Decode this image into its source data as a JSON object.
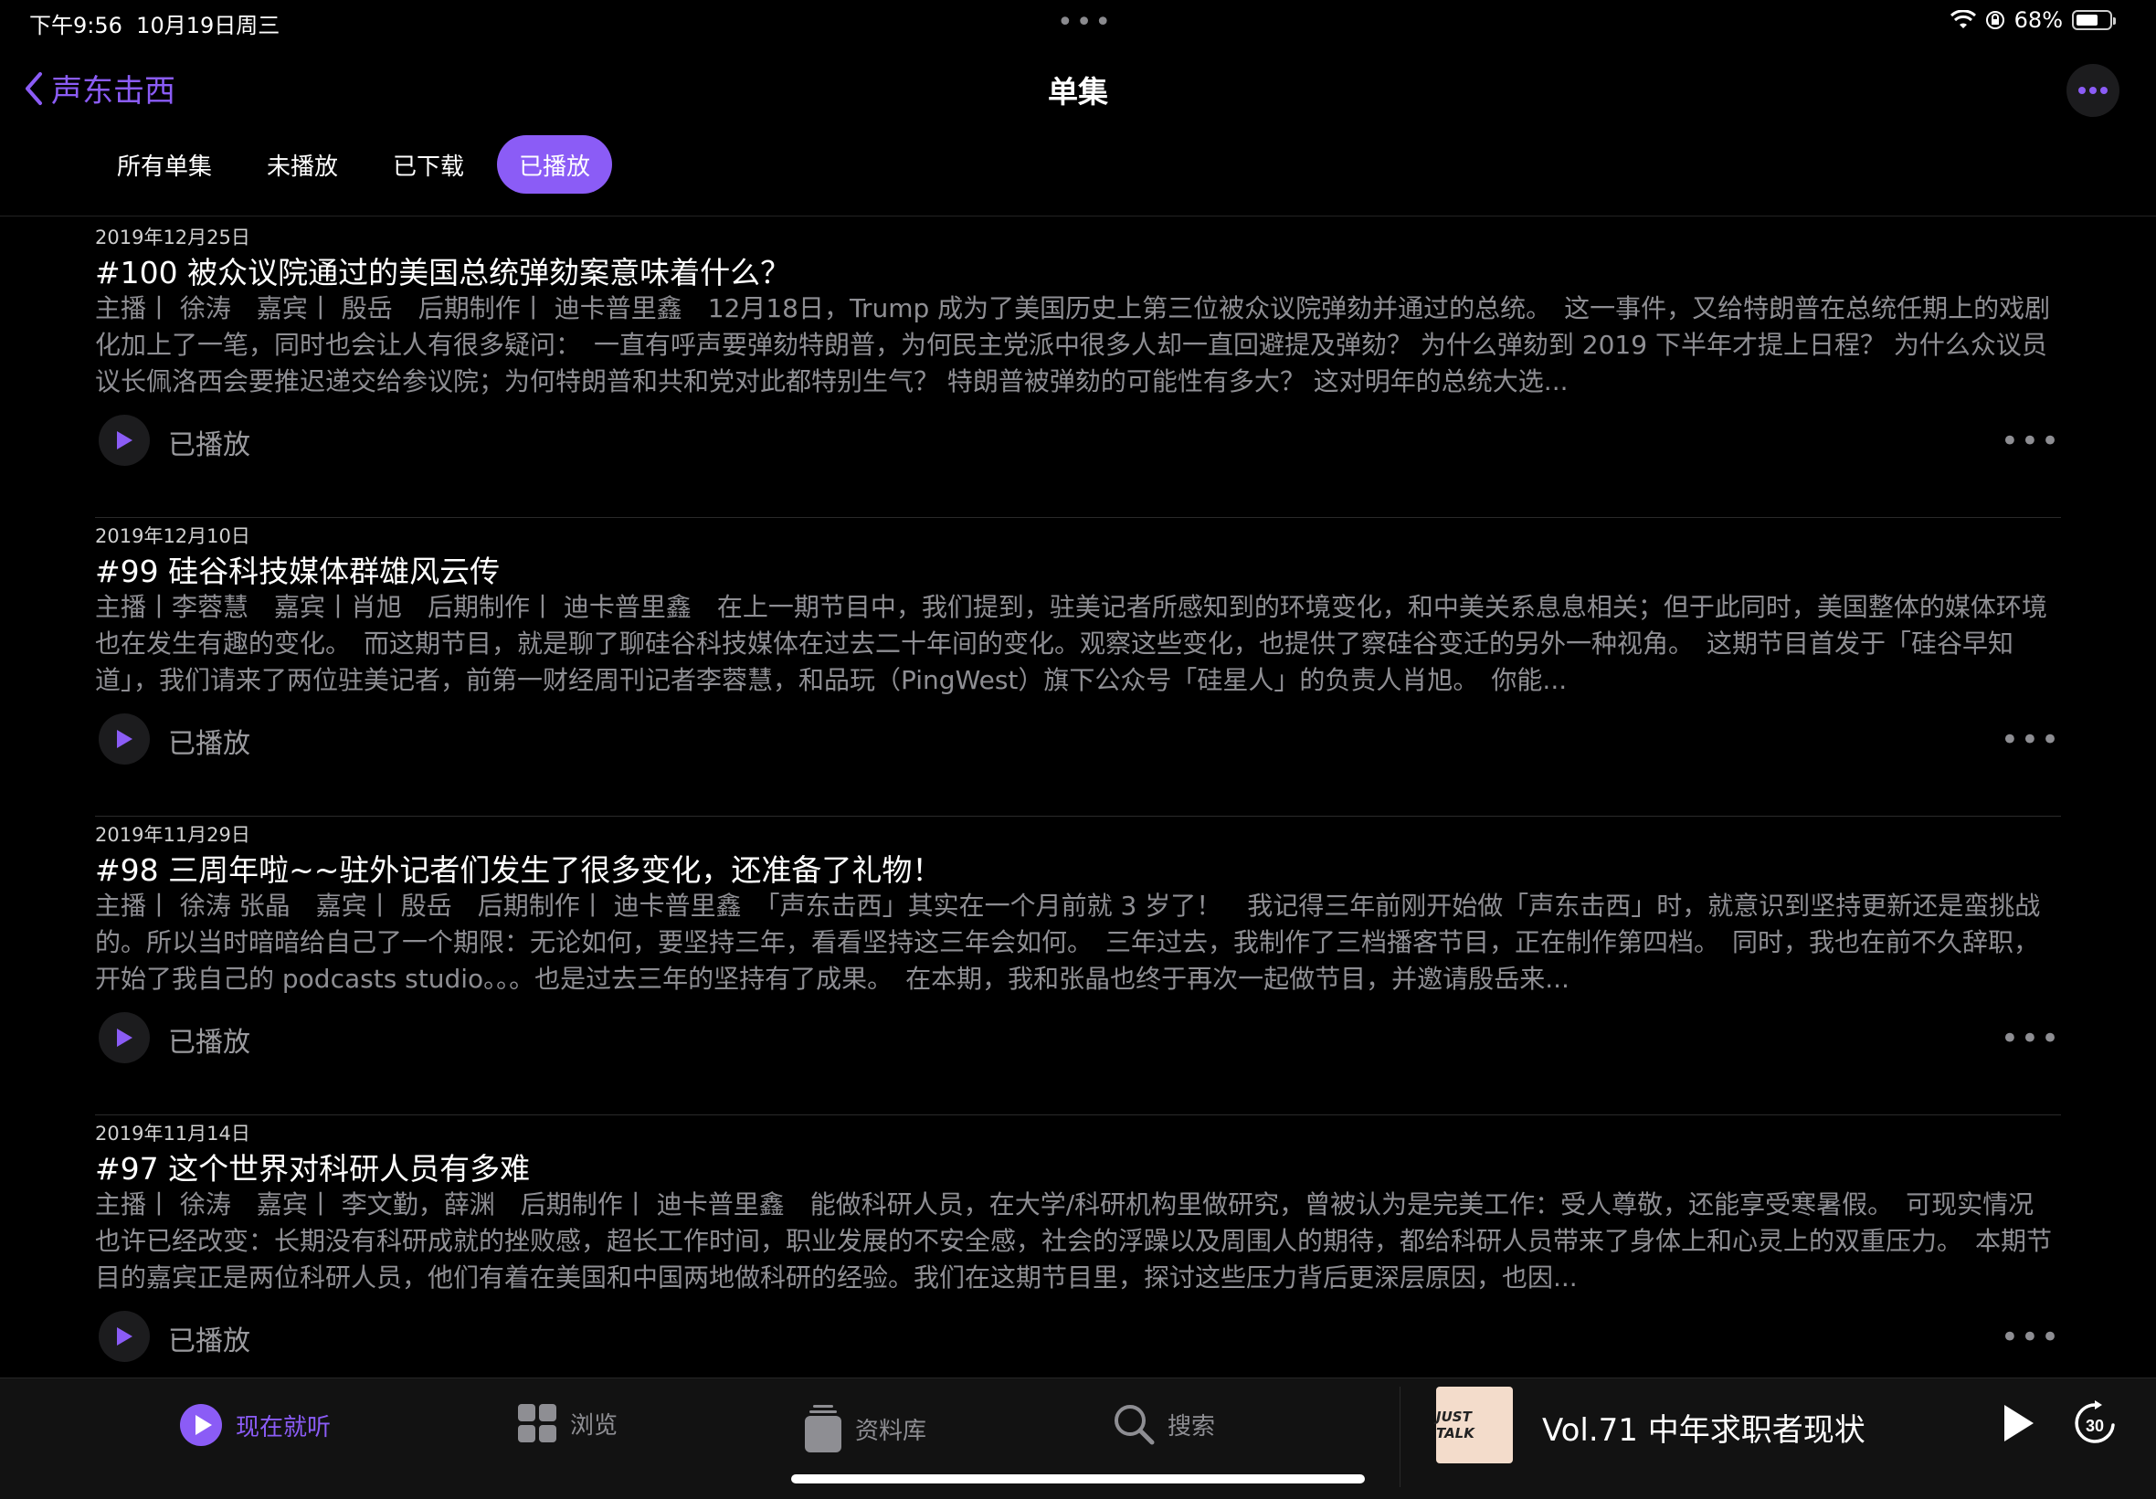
{
  "status_bar": {
    "time": "下午9:56",
    "date": "10月19日周三",
    "battery": "68%",
    "battery_level": 0.68
  },
  "nav": {
    "back_label": "声东击西",
    "title": "单集"
  },
  "tabs": [
    {
      "label": "所有单集",
      "active": false
    },
    {
      "label": "未播放",
      "active": false
    },
    {
      "label": "已下载",
      "active": false
    },
    {
      "label": "已播放",
      "active": true
    }
  ],
  "episodes": [
    {
      "date": "2019年12月25日",
      "title": "#100 被众议院通过的美国总统弹劾案意味着什么？",
      "description": "主播丨 徐涛　嘉宾丨 殷岳　后期制作丨 迪卡普里鑫　12月18日，Trump 成为了美国历史上第三位被众议院弹劾并通过的总统。　这一事件，又给特朗普在总统任期上的戏剧化加上了一笔，同时也会让人有很多疑问：　一直有呼声要弹劾特朗普，为何民主党派中很多人却一直回避提及弹劾？ 为什么弹劾到 2019 下半年才提上日程？ 为什么众议员议长佩洛西会要推迟递交给参议院；为何特朗普和共和党对此都特别生气？ 特朗普被弹劾的可能性有多大？ 这对明年的总统大选...",
      "status": "已播放"
    },
    {
      "date": "2019年12月10日",
      "title": "#99 硅谷科技媒体群雄风云传",
      "description": "主播丨李蓉慧　嘉宾丨肖旭　后期制作丨 迪卡普里鑫　在上一期节目中，我们提到，驻美记者所感知到的环境变化，和中美关系息息相关；但于此同时，美国整体的媒体环境也在发生有趣的变化。　而这期节目，就是聊了聊硅谷科技媒体在过去二十年间的变化。观察这些变化，也提供了察硅谷变迁的另外一种视角。　这期节目首发于「硅谷早知道」，我们请来了两位驻美记者，前第一财经周刊记者李蓉慧，和品玩（PingWest）旗下公众号「硅星人」的负责人肖旭。　你能...",
      "status": "已播放"
    },
    {
      "date": "2019年11月29日",
      "title": "#98 三周年啦~~驻外记者们发生了很多变化，还准备了礼物！",
      "description": "主播丨 徐涛 张晶　嘉宾丨 殷岳　后期制作丨 迪卡普里鑫　「声东击西」其实在一个月前就 3 岁了！　我记得三年前刚开始做「声东击西」时，就意识到坚持更新还是蛮挑战的。所以当时暗暗给自己了一个期限：无论如何，要坚持三年，看看坚持这三年会如何。　三年过去，我制作了三档播客节目，正在制作第四档。　同时，我也在前不久辞职，开始了我自己的 podcasts studio。。。也是过去三年的坚持有了成果。　在本期，我和张晶也终于再次一起做节目，并邀请殷岳来...",
      "status": "已播放"
    },
    {
      "date": "2019年11月14日",
      "title": "#97 这个世界对科研人员有多难",
      "description": "主播丨 徐涛　嘉宾丨 李文勤，薛渊　后期制作丨 迪卡普里鑫　能做科研人员，在大学/科研机构里做研究，曾被认为是完美工作：受人尊敬，还能享受寒暑假。　可现实情况也许已经改变：长期没有科研成就的挫败感，超长工作时间，职业发展的不安全感，社会的浮躁以及周围人的期待，都给科研人员带来了身体上和心灵上的双重压力。　本期节目的嘉宾正是两位科研人员，他们有着在美国和中国两地做科研的经验。我们在这期节目里，探讨这些压力背后更深层原因，也因...",
      "status": "已播放"
    }
  ],
  "tab_bar": {
    "listen_now": "现在就听",
    "browse": "浏览",
    "library": "资料库",
    "search": "搜索"
  },
  "now_playing": {
    "title": "Vol.71 中年求职者现状",
    "artwork_text": "JUST TALK",
    "skip_seconds": "30"
  },
  "colors": {
    "accent": "#8b5cf6",
    "background": "#000000",
    "secondary_text": "#8e8e93"
  }
}
